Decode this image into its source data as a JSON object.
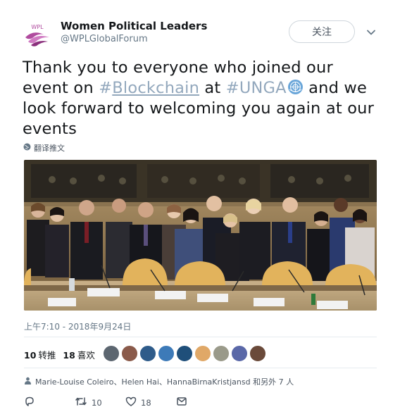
{
  "account": {
    "name": "Women Political Leaders",
    "handle": "@WPLGlobalForum",
    "avatar_text": "WPL",
    "follow_label": "关注"
  },
  "tweet": {
    "text_part1": "Thank you to everyone who joined our event on ",
    "hashtag1_symbol": "#",
    "hashtag1_word": "Blockchain",
    "text_part2": " at ",
    "hashtag2": "#UNGA",
    "text_part3": " and we look forward to welcoming you again at our events",
    "translate_label": "翻译推文"
  },
  "timestamp": "上午7:10 - 2018年9月24日",
  "stats": {
    "retweets_count": "10",
    "retweets_label": "转推",
    "likes_count": "18",
    "likes_label": "喜欢"
  },
  "liked_by": "Marie-Louise Coleiro、Helen Hai、HannaBirnaKristjansd 和另外 7 人",
  "actions": {
    "reply_count": "",
    "retweet_count": "10",
    "like_count": "18"
  },
  "colors": {
    "hashtag": "#93a8bd",
    "text": "#14171a",
    "muted": "#657786",
    "brand_purple": "#b04b9e"
  },
  "icons": [
    "caret-down-icon",
    "globe-icon",
    "un-emblem-icon",
    "reply-icon",
    "retweet-icon",
    "heart-icon",
    "dm-icon"
  ]
}
